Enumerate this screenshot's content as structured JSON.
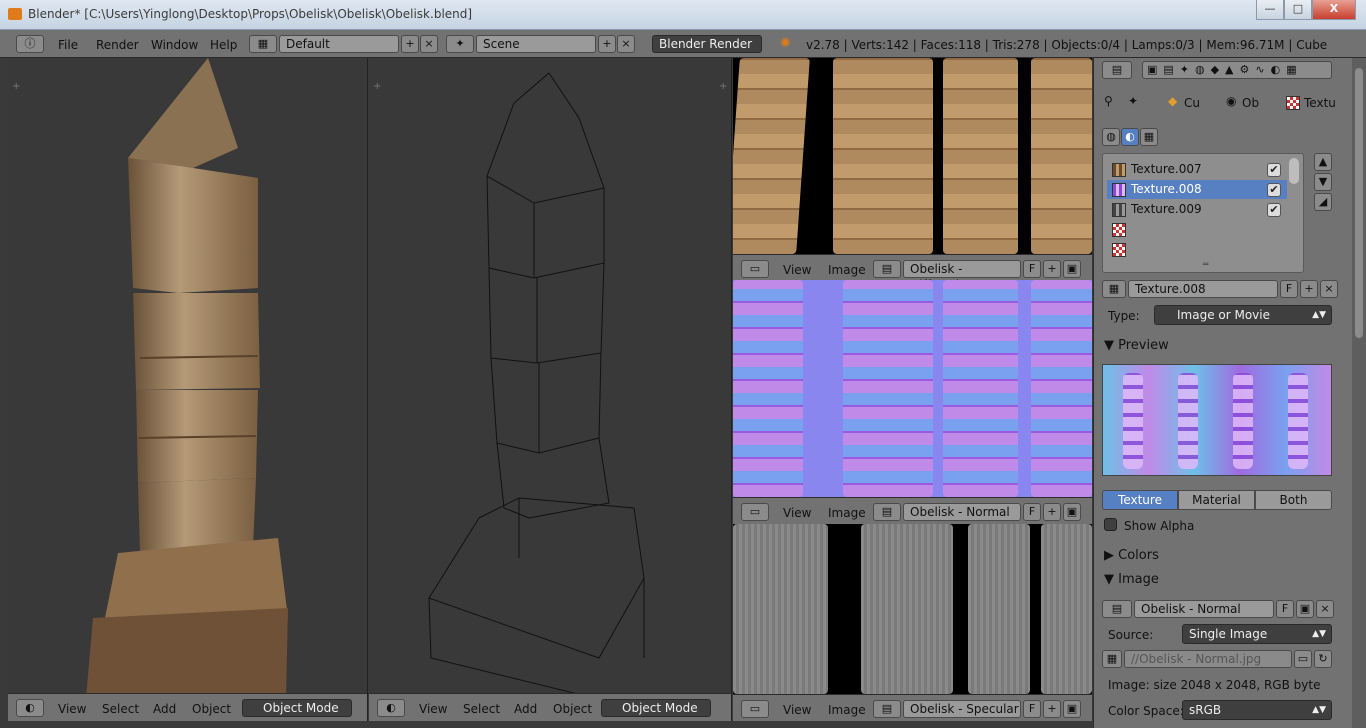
{
  "window": {
    "title": "Blender* [C:\\Users\\Yinglong\\Desktop\\Props\\Obelisk\\Obelisk\\Obelisk.blend]",
    "min": "—",
    "max": "□",
    "close": "X"
  },
  "info_header": {
    "menus": [
      "File",
      "Render",
      "Window",
      "Help"
    ],
    "screen_layout": "Default",
    "scene": "Scene",
    "render_engine": "Blender Render",
    "stats": "v2.78 | Verts:142 | Faces:118 | Tris:278 | Objects:0/4 | Lamps:0/3 | Mem:96.71M | Cube"
  },
  "viewport_textured": {
    "menus": [
      "View",
      "Select",
      "Add",
      "Object"
    ],
    "mode": "Object Mode"
  },
  "viewport_wire": {
    "menus": [
      "View",
      "Select",
      "Add",
      "Object"
    ],
    "mode": "Object Mode"
  },
  "image_editors": [
    {
      "menus": [
        "View",
        "Image"
      ],
      "image": "Obelisk - Diffuse.jpg",
      "fake": "F"
    },
    {
      "menus": [
        "View",
        "Image"
      ],
      "image": "Obelisk - Normal",
      "fake": "F"
    },
    {
      "menus": [
        "View",
        "Image"
      ],
      "image": "Obelisk - Specular",
      "fake": "F"
    }
  ],
  "properties": {
    "breadcrumb": [
      "Cu",
      "Ob",
      "Textu"
    ],
    "texture_slots": [
      {
        "name": "Texture.007",
        "selected": false
      },
      {
        "name": "Texture.008",
        "selected": true
      },
      {
        "name": "Texture.009",
        "selected": false
      },
      {
        "name": "",
        "selected": false
      },
      {
        "name": "",
        "selected": false
      }
    ],
    "texture_name": "Texture.008",
    "fake": "F",
    "type_label": "Type:",
    "type_value": "Image or Movie",
    "preview_panel": "Preview",
    "preview_tabs": [
      "Texture",
      "Material",
      "Both"
    ],
    "show_alpha": "Show Alpha",
    "colors_panel": "Colors",
    "image_panel": "Image",
    "image_name": "Obelisk - Normal",
    "source_label": "Source:",
    "source_value": "Single Image",
    "filepath": "//Obelisk - Normal.jpg",
    "image_info": "Image: size 2048 x 2048, RGB byte",
    "color_space_label": "Color Space:",
    "color_space_value": "sRGB"
  },
  "colors": {
    "selection": "#5680c2",
    "header": "#727272",
    "viewport_bg": "#393939"
  }
}
